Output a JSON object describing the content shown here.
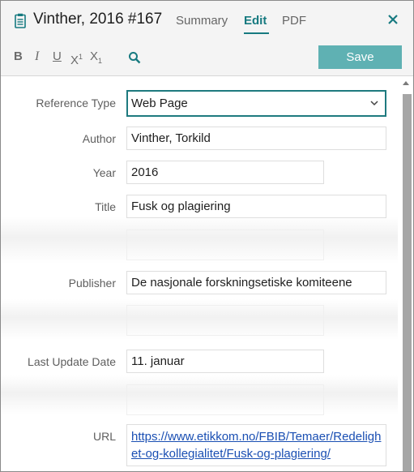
{
  "header": {
    "title": "Vinther, 2016 #167",
    "tabs": [
      "Summary",
      "Edit",
      "PDF"
    ],
    "active_tab": "Edit",
    "save_label": "Save",
    "accent_color": "#177a80",
    "save_color": "#5fb1b3",
    "icons": [
      "document-icon",
      "close-icon",
      "search-icon"
    ]
  },
  "toolbar": {
    "bold": "B",
    "italic": "I",
    "underline": "U",
    "superscript_base": "X",
    "superscript_mark": "1",
    "subscript_base": "X",
    "subscript_mark": "1"
  },
  "form": {
    "reference_type": {
      "label": "Reference Type",
      "value": "Web Page"
    },
    "author": {
      "label": "Author",
      "value": "Vinther, Torkild"
    },
    "year": {
      "label": "Year",
      "value": "2016"
    },
    "title": {
      "label": "Title",
      "value": "Fusk og plagiering"
    },
    "publisher": {
      "label": "Publisher",
      "value": "De nasjonale forskningsetiske komiteene"
    },
    "last_update_date": {
      "label": "Last Update Date",
      "value": "11. januar"
    },
    "url": {
      "label": "URL",
      "value": "https://www.etikkom.no/FBIB/Temaer/Redelighet-og-kollegialitet/Fusk-og-plagiering/"
    }
  }
}
